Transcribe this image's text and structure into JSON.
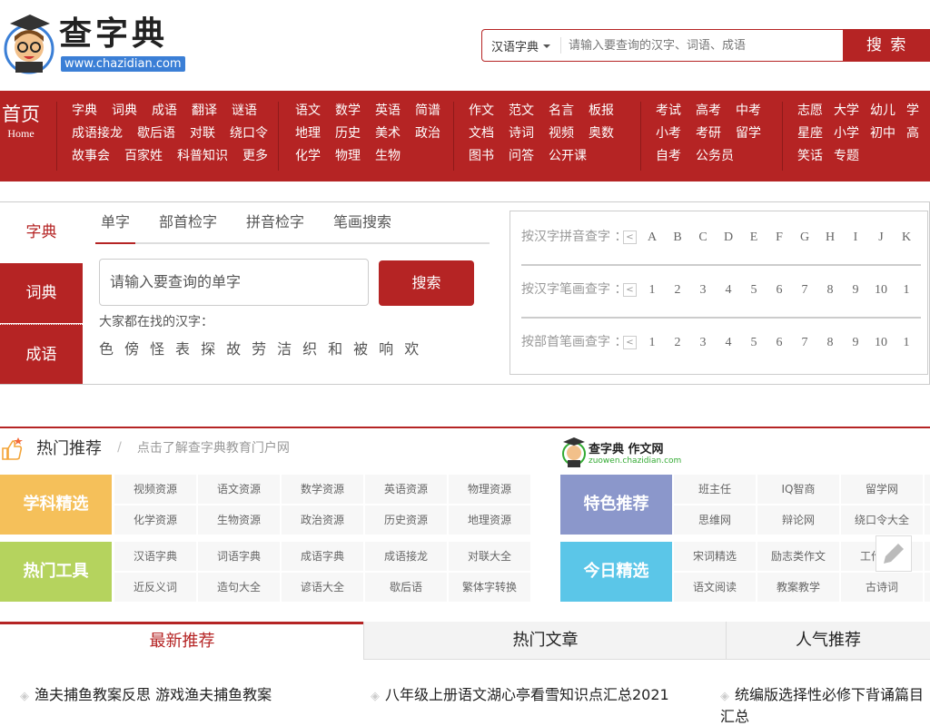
{
  "header": {
    "logo_text": "查字典",
    "logo_url": "www.chazidian.com",
    "search_type": "汉语字典",
    "search_placeholder": "请输入要查询的汉字、词语、成语",
    "search_button": "搜 索"
  },
  "nav": {
    "home": "首页",
    "home_en": "Home",
    "groups": [
      [
        [
          "字典",
          "词典",
          "成语",
          "翻译",
          "谜语"
        ],
        [
          "成语接龙",
          "歇后语",
          "对联",
          "绕口令"
        ],
        [
          "故事会",
          "百家姓",
          "科普知识",
          "更多"
        ]
      ],
      [
        [
          "语文",
          "数学",
          "英语",
          "简谱"
        ],
        [
          "地理",
          "历史",
          "美术",
          "政治"
        ],
        [
          "化学",
          "物理",
          "生物"
        ]
      ],
      [
        [
          "作文",
          "范文",
          "名言",
          "板报"
        ],
        [
          "文档",
          "诗词",
          "视频",
          "奥数"
        ],
        [
          "图书",
          "问答",
          "公开课"
        ]
      ],
      [
        [
          "考试",
          "高考",
          "中考"
        ],
        [
          "小考",
          "考研",
          "留学"
        ],
        [
          "自考",
          "公务员"
        ]
      ],
      [
        [
          "志愿",
          "大学",
          "幼儿",
          "学"
        ],
        [
          "星座",
          "小学",
          "初中",
          "高"
        ],
        [
          "笑话",
          "专题"
        ]
      ]
    ]
  },
  "dict": {
    "left_tabs": [
      "字典",
      "词典",
      "成语"
    ],
    "sub_tabs": [
      "单字",
      "部首检字",
      "拼音检字",
      "笔画搜索"
    ],
    "input_placeholder": "请输入要查询的单字",
    "search_button": "搜索",
    "hot_label": "大家都在找的汉字：",
    "hot_chars": [
      "色",
      "傍",
      "怪",
      "表",
      "探",
      "故",
      "劳",
      "洁",
      "织",
      "和",
      "被",
      "响",
      "欢"
    ],
    "index_rows": [
      {
        "label": "按汉字拼音查字 ：",
        "keys": [
          "A",
          "B",
          "C",
          "D",
          "E",
          "F",
          "G",
          "H",
          "I",
          "J",
          "K"
        ]
      },
      {
        "label": "按汉字笔画查字 ：",
        "keys": [
          "1",
          "2",
          "3",
          "4",
          "5",
          "6",
          "7",
          "8",
          "9",
          "10",
          "1"
        ]
      },
      {
        "label": "按部首笔画查字 ：",
        "keys": [
          "1",
          "2",
          "3",
          "4",
          "5",
          "6",
          "7",
          "8",
          "9",
          "10",
          "1"
        ]
      }
    ]
  },
  "hot": {
    "title": "热门推荐",
    "sep": "/",
    "subtitle": "点击了解查字典教育门户网",
    "zuowen_logo": "查字典 作文网",
    "zuowen_url": "zuowen.chazidian.com",
    "blocks": [
      {
        "label": "学科精选",
        "color": "#f5c05a",
        "cells": [
          "视频资源",
          "语文资源",
          "数学资源",
          "英语资源",
          "物理资源",
          "化学资源",
          "生物资源",
          "政治资源",
          "历史资源",
          "地理资源"
        ]
      },
      {
        "label": "热门工具",
        "color": "#b5d35e",
        "cells": [
          "汉语字典",
          "词语字典",
          "成语字典",
          "成语接龙",
          "对联大全",
          "近反义词",
          "造句大全",
          "谚语大全",
          "歇后语",
          "繁体字转换"
        ]
      },
      {
        "label": "特色推荐",
        "color": "#8b97cb",
        "cells": [
          "班主任",
          "IQ智商",
          "留学网",
          "思维网",
          "辩论网",
          "绕口令大全"
        ]
      },
      {
        "label": "今日精选",
        "color": "#5bc6e8",
        "cells": [
          "宋词精选",
          "励志类作文",
          "工作计划",
          "语文阅读",
          "教案教学",
          "古诗词"
        ]
      }
    ]
  },
  "articles": {
    "tabs": [
      "最新推荐",
      "热门文章",
      "人气推荐"
    ],
    "items": [
      "渔夫捕鱼教案反思 游戏渔夫捕鱼教案",
      "八年级上册语文湖心亭看雪知识点汇总2021",
      "统编版选择性必修下背诵篇目汇总"
    ]
  },
  "colors": {
    "brand_red": "#b52424"
  }
}
